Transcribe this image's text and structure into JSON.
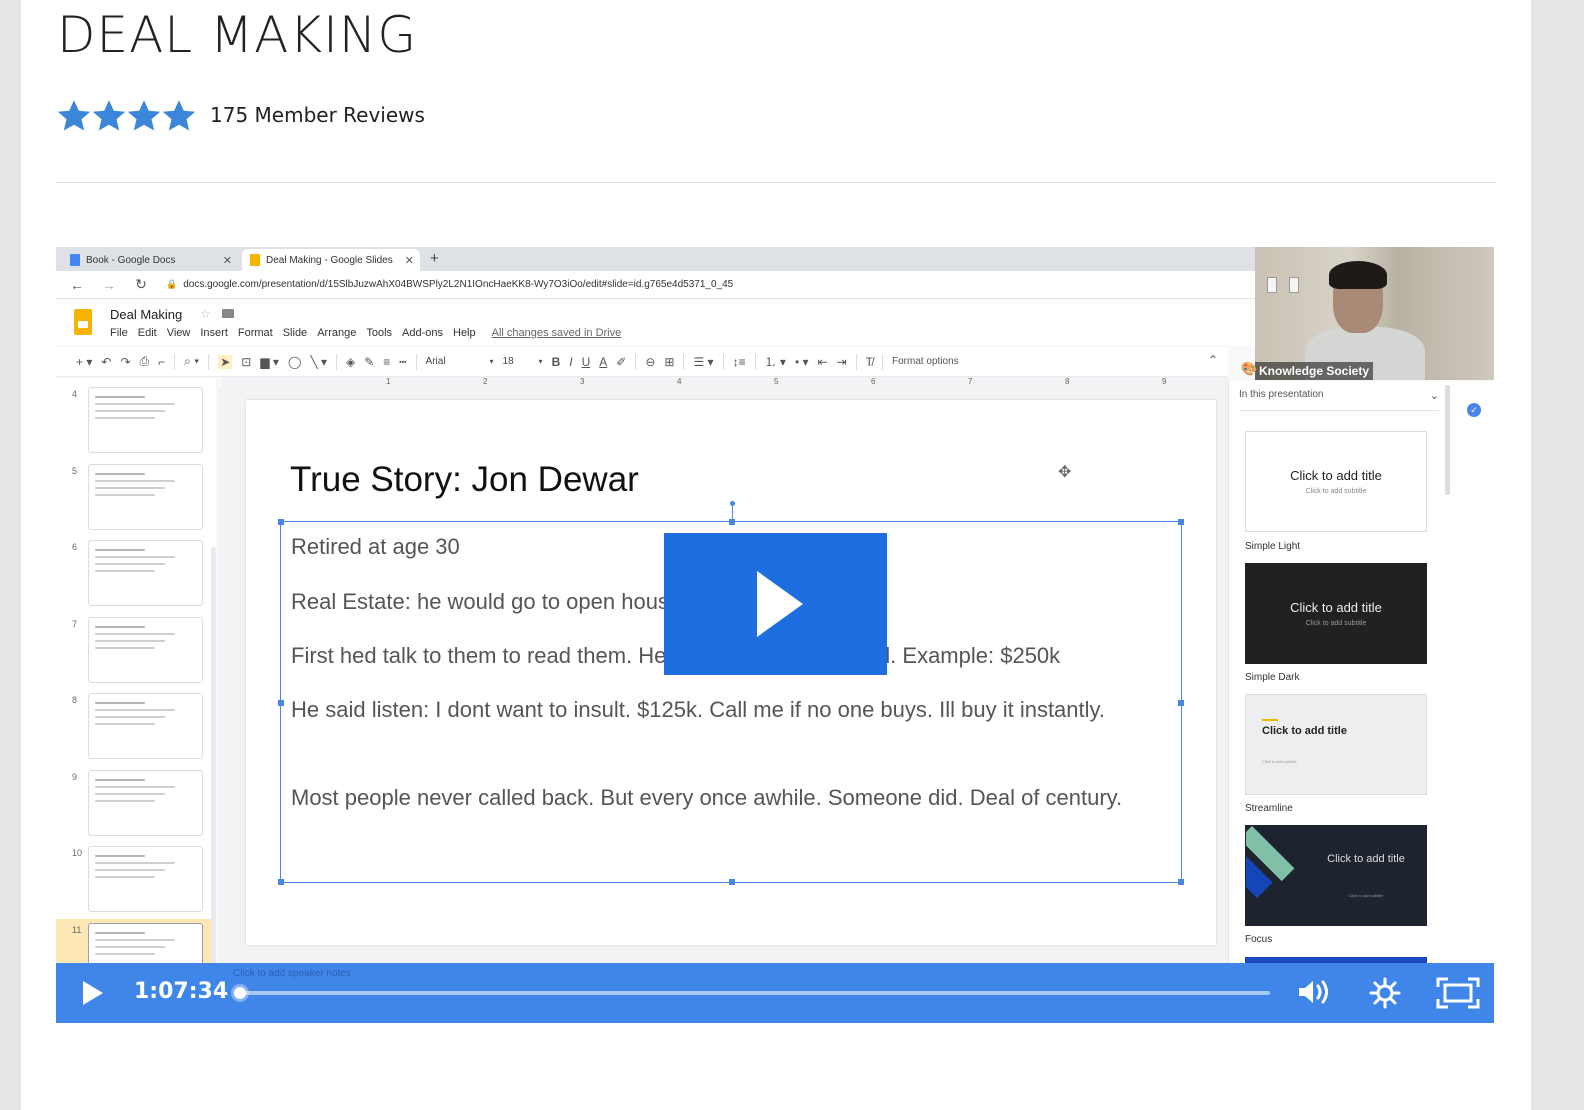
{
  "course": {
    "title": "DEAL MAKING",
    "rating": {
      "stars": 4,
      "max_stars": 4,
      "reviews_label": "175 Member Reviews"
    }
  },
  "browser": {
    "tabs": [
      {
        "label": "Book - Google Docs",
        "icon": "google-docs-icon",
        "color": "#4285f4"
      },
      {
        "label": "Deal Making - Google Slides",
        "icon": "google-slides-icon",
        "color": "#f4b400",
        "active": true
      }
    ],
    "url": "docs.google.com/presentation/d/15SlbJuzwAhX04BWSPly2L2N1IOncHaeKK8-Wy7O3iOo/edit#slide=id.g765e4d5371_0_45"
  },
  "slides_app": {
    "doc_title": "Deal Making",
    "menu": [
      "File",
      "Edit",
      "View",
      "Insert",
      "Format",
      "Slide",
      "Arrange",
      "Tools",
      "Add-ons",
      "Help"
    ],
    "save_status": "All changes saved in Drive",
    "toolbar": {
      "font": "Arial",
      "font_size": "18",
      "format_options": "Format options"
    },
    "ruler_numbers": [
      "1",
      "2",
      "3",
      "4",
      "5",
      "6",
      "7",
      "8",
      "9"
    ],
    "filmstrip": [
      {
        "num": "4"
      },
      {
        "num": "5"
      },
      {
        "num": "6"
      },
      {
        "num": "7"
      },
      {
        "num": "8"
      },
      {
        "num": "9"
      },
      {
        "num": "10"
      },
      {
        "num": "11",
        "active": true
      }
    ],
    "slide": {
      "title": "True Story: Jon Dewar",
      "paragraphs": [
        "Retired at age 30",
        "Real Estate: he would go to open house. LOTS OF THEM.",
        "First hed talk to them to read them. He would leave a biz card. Example: $250k",
        "He said listen: I dont want to insult. $125k. Call me if no one buys. Ill buy it instantly.",
        "Most people never called back. But every once awhile. Someone did. Deal of century."
      ]
    },
    "themes": {
      "header": "In this presentation",
      "items": [
        {
          "name": "Simple Light",
          "title": "Click to add title",
          "subtitle": "Click to add subtitle"
        },
        {
          "name": "Simple Dark",
          "title": "Click to add title",
          "subtitle": "Click to add subtitle"
        },
        {
          "name": "Streamline",
          "title": "Click to add title",
          "subtitle": "Click to add subtitle"
        },
        {
          "name": "Focus",
          "title": "Click to add title",
          "subtitle": "Click to add subtitle"
        }
      ]
    },
    "speaker_notes_placeholder": "Click to add speaker notes"
  },
  "webcam": {
    "label": "Knowledge Society"
  },
  "player": {
    "time": "1:07:34",
    "progress_fraction": 0.0,
    "accent": "#3f86e8",
    "big_play_color": "#1d6fe0"
  }
}
